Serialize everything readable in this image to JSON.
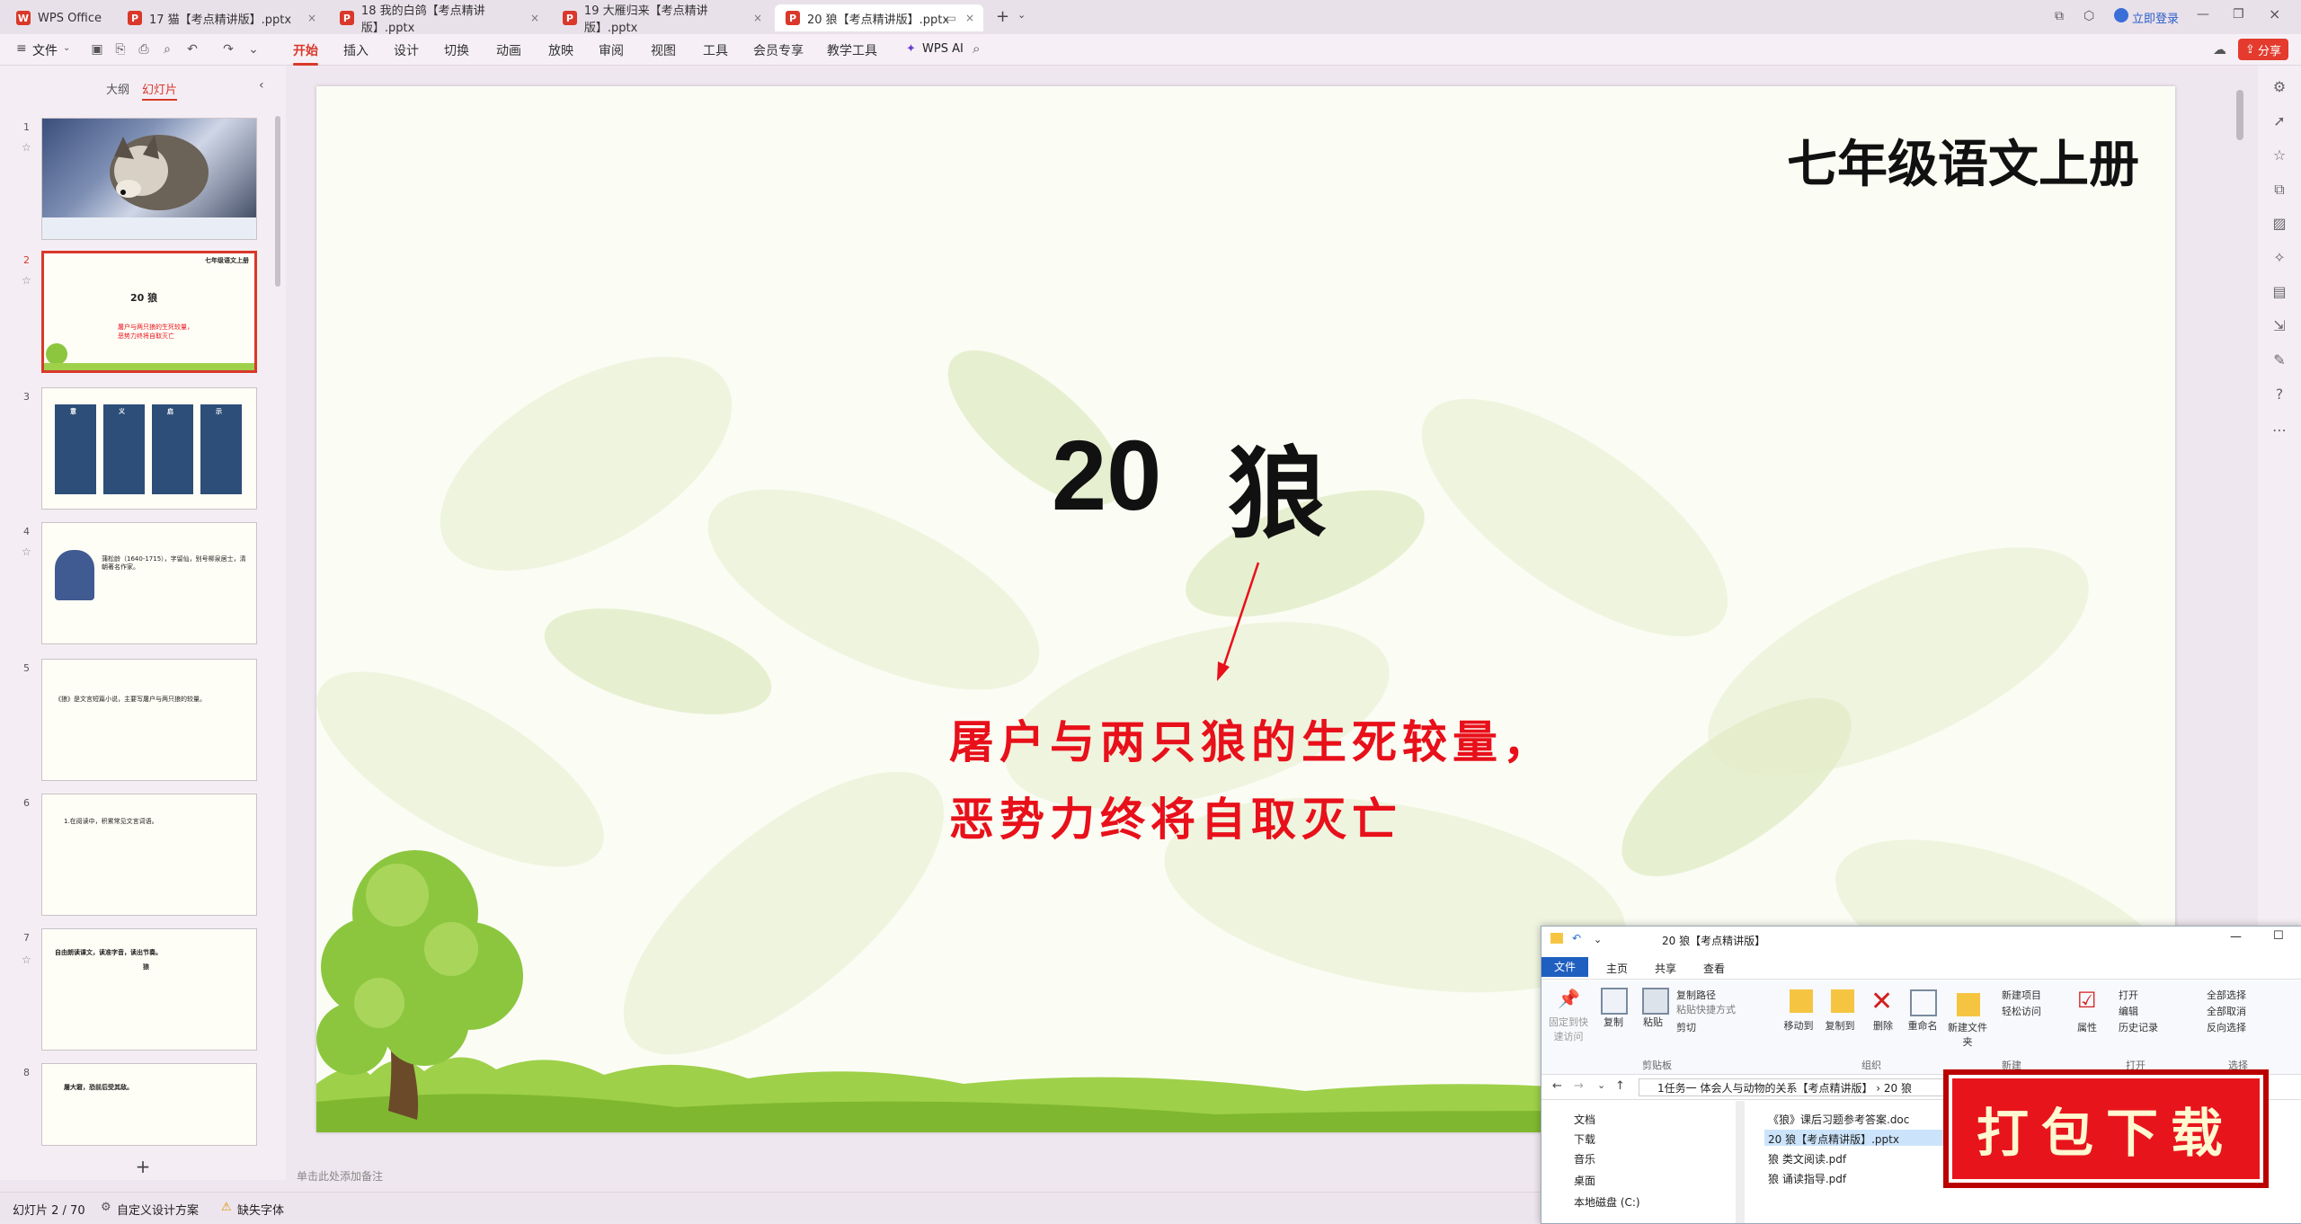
{
  "tabs": [
    {
      "label": "WPS Office",
      "icon": "wps-logo-icon"
    },
    {
      "label": "17 猫【考点精讲版】.pptx",
      "icon": "pptx-icon"
    },
    {
      "label": "18 我的白鸽【考点精讲版】.pptx",
      "icon": "pptx-icon"
    },
    {
      "label": "19 大雁归来【考点精讲版】.pptx",
      "icon": "pptx-icon"
    },
    {
      "label": "20 狼【考点精讲版】.pptx",
      "icon": "pptx-icon",
      "active": true
    }
  ],
  "titlebar": {
    "login": "立即登录"
  },
  "ribbon": {
    "file_menu": "文件",
    "tabs": [
      "开始",
      "插入",
      "设计",
      "切换",
      "动画",
      "放映",
      "审阅",
      "视图",
      "工具",
      "会员专享",
      "教学工具"
    ],
    "wps_ai": "WPS AI",
    "share": "分享"
  },
  "left_panel": {
    "view_tabs": [
      "大纲",
      "幻灯片"
    ],
    "active_view": "幻灯片",
    "slide_numbers": [
      "1",
      "2",
      "3",
      "4",
      "5",
      "6",
      "7",
      "8"
    ],
    "thumb2": {
      "header": "七年级语文上册",
      "title": "20 狼",
      "line1": "屠户与两只狼的生死较量，",
      "line2": "恶势力终将自取灭亡"
    },
    "thumb3": {
      "heads": [
        "意",
        "义",
        "启",
        "示"
      ]
    },
    "thumb4": {
      "text": "蒲松龄（1640-1715），字留仙，别号柳泉居士，清朝著名作家。"
    },
    "thumb5": {
      "text": "《狼》是文言短篇小说，主要写屠户与两只狼的较量。"
    },
    "thumb6": {
      "text": "1.在阅读中，积累常见文言词语。"
    },
    "thumb7": {
      "text": "自由朗读课文，读准字音，读出节奏。",
      "sub": "狼"
    },
    "thumb8": {
      "text": "屠大窘，恐前后受其敌。"
    },
    "add_slide": "+"
  },
  "slide": {
    "header": "七年级语文上册",
    "title_num": "20",
    "title_char": "狼",
    "line1": "屠户与两只狼的生死较量，",
    "line2": "恶势力终将自取灭亡",
    "accent": "#e8101a"
  },
  "notes": {
    "placeholder": "单击此处添加备注"
  },
  "status": {
    "slide_info": "幻灯片 2 / 70",
    "design": "自定义设计方案",
    "missing_font": "缺失字体"
  },
  "explorer": {
    "title": "20 狼【考点精讲版】",
    "ribbon_tabs": [
      "文件",
      "主页",
      "共享",
      "查看"
    ],
    "buttons": {
      "pin": "固定到快速访问",
      "copy": "复制",
      "paste": "粘贴",
      "copy_path": "复制路径",
      "paste_shortcut": "粘贴快捷方式",
      "cut": "剪切",
      "move_to": "移动到",
      "copy_to": "复制到",
      "delete": "删除",
      "rename": "重命名",
      "new_folder": "新建文件夹",
      "new_item": "新建项目",
      "easy_access": "轻松访问",
      "properties": "属性",
      "open": "打开",
      "edit": "编辑",
      "history": "历史记录",
      "select_all": "全部选择",
      "select_none": "全部取消",
      "invert": "反向选择"
    },
    "groups": [
      "剪贴板",
      "组织",
      "新建",
      "打开",
      "选择"
    ],
    "path": "1任务一 体会人与动物的关系【考点精讲版】 › 20 狼",
    "nav": [
      "文档",
      "下载",
      "音乐",
      "桌面",
      "本地磁盘 (C:)"
    ],
    "files": [
      "《狼》课后习题参考答案.doc",
      "20 狼【考点精讲版】.pptx",
      "狼 类文阅读.pdf",
      "狼 诵读指导.pdf"
    ]
  },
  "download_badge": "打包下载"
}
